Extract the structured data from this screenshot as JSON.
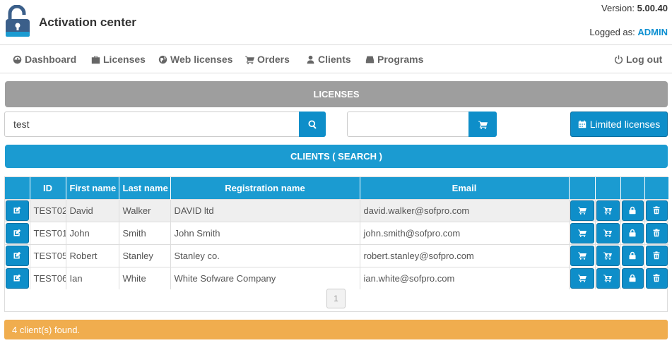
{
  "header": {
    "app_title": "Activation center",
    "version_label": "Version:",
    "version_value": "5.00.40",
    "logged_label": "Logged as:",
    "logged_user": "ADMIN"
  },
  "nav": {
    "items": [
      {
        "label": "Dashboard",
        "icon": "dashboard-icon"
      },
      {
        "label": "Licenses",
        "icon": "briefcase-icon"
      },
      {
        "label": "Web licenses",
        "icon": "globe-icon"
      },
      {
        "label": "Orders",
        "icon": "cart-icon"
      },
      {
        "label": "Clients",
        "icon": "user-icon"
      },
      {
        "label": "Programs",
        "icon": "hdd-icon"
      }
    ],
    "logout_label": "Log out"
  },
  "licenses_banner": "LICENSES",
  "search": {
    "query_value": "test",
    "order_value": ""
  },
  "limited_licenses_label": "Limited licenses",
  "clients_banner": "CLIENTS ( SEARCH )",
  "table": {
    "columns": [
      "",
      "ID",
      "First name",
      "Last name",
      "Registration name",
      "Email",
      "",
      "",
      "",
      ""
    ],
    "rows": [
      {
        "id": "TEST02",
        "first": "David",
        "last": "Walker",
        "reg": "DAVID ltd",
        "email": "david.walker@sofpro.com"
      },
      {
        "id": "TEST01",
        "first": "John",
        "last": "Smith",
        "reg": "John Smith",
        "email": "john.smith@sofpro.com"
      },
      {
        "id": "TEST05",
        "first": "Robert",
        "last": "Stanley",
        "reg": "Stanley co.",
        "email": "robert.stanley@sofpro.com"
      },
      {
        "id": "TEST06",
        "first": "Ian",
        "last": "White",
        "reg": "White Sofware Company",
        "email": "ian.white@sofpro.com"
      }
    ]
  },
  "pager": {
    "current_page": "1"
  },
  "status": "4 client(s) found.",
  "colors": {
    "accent": "#1b9bd1",
    "button": "#0e8ec9",
    "warning": "#f0ad4e",
    "gray_banner": "#9e9e9e"
  }
}
